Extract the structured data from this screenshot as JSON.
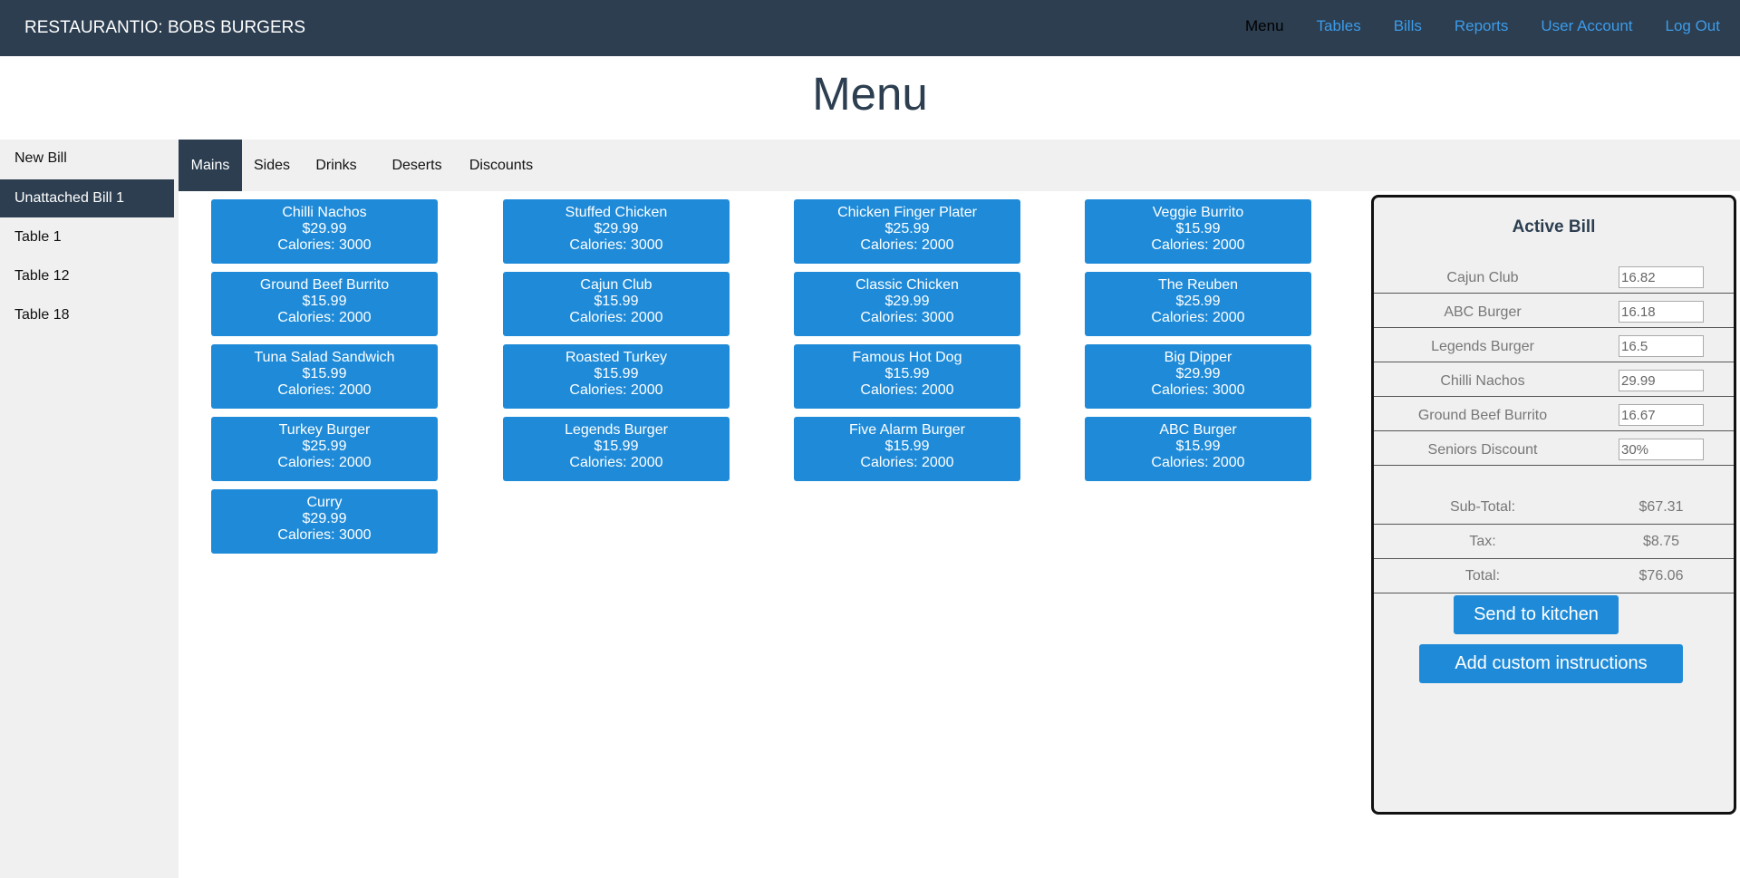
{
  "app": {
    "brand": "RESTAURANTIO: BOBS BURGERS",
    "nav": [
      "Menu",
      "Tables",
      "Bills",
      "Reports",
      "User Account",
      "Log Out"
    ],
    "active_nav": "Menu"
  },
  "page_title": "Menu",
  "sidebar": {
    "items": [
      {
        "label": "New Bill"
      },
      {
        "label": "Unattached Bill 1"
      },
      {
        "label": "Table 1"
      },
      {
        "label": "Table 12"
      },
      {
        "label": "Table 18"
      }
    ],
    "active": "Unattached Bill 1"
  },
  "tabs": [
    {
      "label": "Mains"
    },
    {
      "label": "Sides"
    },
    {
      "label": "Drinks"
    },
    {
      "label": "Deserts"
    },
    {
      "label": "Discounts"
    }
  ],
  "active_tab": "Mains",
  "menu_items": [
    {
      "name": "Chilli Nachos",
      "price": "$29.99",
      "calories": "Calories: 3000"
    },
    {
      "name": "Stuffed Chicken",
      "price": "$29.99",
      "calories": "Calories: 3000"
    },
    {
      "name": "Chicken Finger Plater",
      "price": "$25.99",
      "calories": "Calories: 2000"
    },
    {
      "name": "Veggie Burrito",
      "price": "$15.99",
      "calories": "Calories: 2000"
    },
    {
      "name": "Ground Beef Burrito",
      "price": "$15.99",
      "calories": "Calories: 2000"
    },
    {
      "name": "Cajun Club",
      "price": "$15.99",
      "calories": "Calories: 2000"
    },
    {
      "name": "Classic Chicken",
      "price": "$29.99",
      "calories": "Calories: 3000"
    },
    {
      "name": "The Reuben",
      "price": "$25.99",
      "calories": "Calories: 2000"
    },
    {
      "name": "Tuna Salad Sandwich",
      "price": "$15.99",
      "calories": "Calories: 2000"
    },
    {
      "name": "Roasted Turkey",
      "price": "$15.99",
      "calories": "Calories: 2000"
    },
    {
      "name": "Famous Hot Dog",
      "price": "$15.99",
      "calories": "Calories: 2000"
    },
    {
      "name": "Big Dipper",
      "price": "$29.99",
      "calories": "Calories: 3000"
    },
    {
      "name": "Turkey Burger",
      "price": "$25.99",
      "calories": "Calories: 2000"
    },
    {
      "name": "Legends Burger",
      "price": "$15.99",
      "calories": "Calories: 2000"
    },
    {
      "name": "Five Alarm Burger",
      "price": "$15.99",
      "calories": "Calories: 2000"
    },
    {
      "name": "ABC Burger",
      "price": "$15.99",
      "calories": "Calories: 2000"
    },
    {
      "name": "Curry",
      "price": "$29.99",
      "calories": "Calories: 3000"
    }
  ],
  "bill": {
    "title": "Active Bill",
    "items": [
      {
        "name": "Cajun Club",
        "value": "16.82"
      },
      {
        "name": "ABC Burger",
        "value": "16.18"
      },
      {
        "name": "Legends Burger",
        "value": "16.5"
      },
      {
        "name": "Chilli Nachos",
        "value": "29.99"
      },
      {
        "name": "Ground Beef Burrito",
        "value": "16.67"
      },
      {
        "name": "Seniors Discount",
        "value": "30%"
      }
    ],
    "subtotal_label": "Sub-Total:",
    "subtotal": "$67.31",
    "tax_label": "Tax:",
    "tax": "$8.75",
    "total_label": "Total:",
    "total": "$76.06",
    "send_label": "Send to kitchen",
    "custom_label": "Add custom instructions"
  },
  "colors": {
    "navbar": "#2c3e50",
    "accent_blue": "#1f8bd8",
    "nav_link": "#3d9be9",
    "panel_bg": "#f0f0f0"
  }
}
